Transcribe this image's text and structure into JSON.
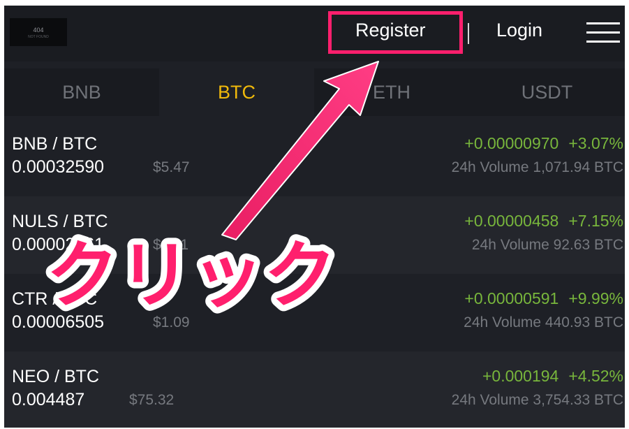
{
  "header": {
    "logo_text": "404",
    "logo_subtext": "NOT FOUND",
    "register_label": "Register",
    "login_label": "Login"
  },
  "tabs": [
    {
      "label": "BNB",
      "active": false
    },
    {
      "label": "BTC",
      "active": true
    },
    {
      "label": "ETH",
      "active": false
    },
    {
      "label": "USDT",
      "active": false
    }
  ],
  "markets": [
    {
      "pair": "BNB / BTC",
      "price": "0.00032590",
      "usd": "$5.47",
      "change": "+0.00000970",
      "percent": "+3.07%",
      "volume": "24h Volume 1,071.94 BTC"
    },
    {
      "pair": "NULS / BTC",
      "price": "0.00002861",
      "usd": "$1.11",
      "change": "+0.00000458",
      "percent": "+7.15%",
      "volume": "24h Volume 92.63 BTC"
    },
    {
      "pair": "CTR / BTC",
      "price": "0.00006505",
      "usd": "$1.09",
      "change": "+0.00000591",
      "percent": "+9.99%",
      "volume": "24h Volume 440.93 BTC"
    },
    {
      "pair": "NEO / BTC",
      "price": "0.004487",
      "usd": "$75.32",
      "change": "+0.000194",
      "percent": "+4.52%",
      "volume": "24h Volume 3,754.33 BTC"
    }
  ],
  "annotation": {
    "text": "クリック",
    "color": "#ff1f6d"
  },
  "colors": {
    "background": "#1e2026",
    "accent": "#f0b90b",
    "positive": "#78b63c",
    "muted": "#76797f",
    "highlight": "#ff1f6d"
  }
}
